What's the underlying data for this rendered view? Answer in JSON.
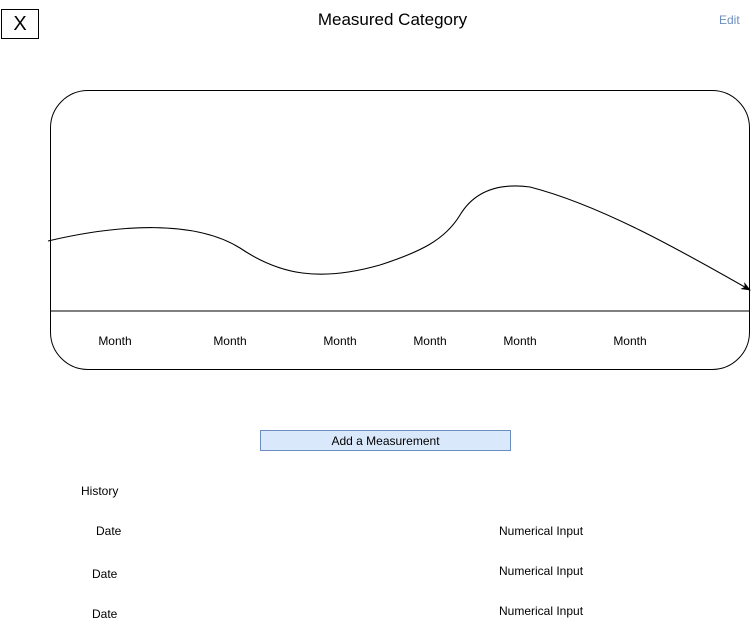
{
  "header": {
    "close_label": "X",
    "title": "Measured Category",
    "edit_label": "Edit"
  },
  "chart_data": {
    "type": "line",
    "categories": [
      "Month",
      "Month",
      "Month",
      "Month",
      "Month",
      "Month"
    ],
    "x_tick_labels": [
      "Month",
      "Month",
      "Month",
      "Month",
      "Month",
      "Month"
    ],
    "series": [
      {
        "values": [
          0.55,
          0.6,
          0.3,
          0.45,
          0.9,
          0.2
        ]
      }
    ],
    "title": "",
    "xlabel": "",
    "ylabel": "",
    "grid": false
  },
  "actions": {
    "add_measurement_label": "Add a Measurement"
  },
  "history": {
    "title": "History",
    "rows": [
      {
        "date": "Date",
        "value": "Numerical Input"
      },
      {
        "date": "Date",
        "value": "Numerical Input"
      },
      {
        "date": "Date",
        "value": "Numerical Input"
      }
    ]
  },
  "colors": {
    "button_fill": "#dae8fc",
    "button_border": "#6c8ebf",
    "link": "#6c8ebf"
  }
}
